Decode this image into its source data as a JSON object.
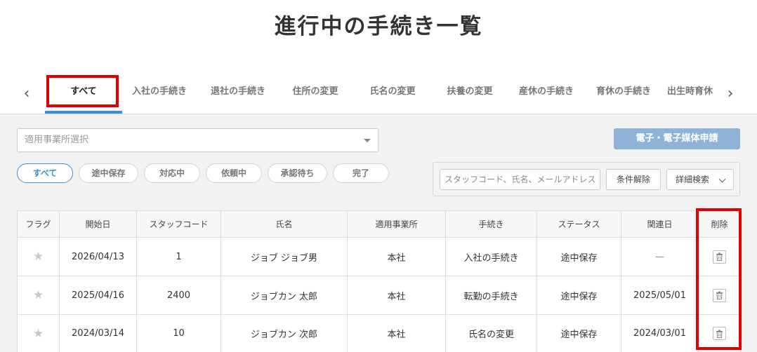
{
  "page": {
    "title": "進行中の手続き一覧"
  },
  "tabs": {
    "items": [
      {
        "label": "すべて"
      },
      {
        "label": "入社の手続き"
      },
      {
        "label": "退社の手続き"
      },
      {
        "label": "住所の変更"
      },
      {
        "label": "氏名の変更"
      },
      {
        "label": "扶養の変更"
      },
      {
        "label": "産休の手続き"
      },
      {
        "label": "育休の手続き"
      },
      {
        "label": "出生時育休"
      }
    ]
  },
  "office_select": {
    "placeholder": "適用事業所選択"
  },
  "apply_button": {
    "label": "電子・電子媒体申請"
  },
  "status_filters": [
    {
      "label": "すべて"
    },
    {
      "label": "途中保存"
    },
    {
      "label": "対応中"
    },
    {
      "label": "依頼中"
    },
    {
      "label": "承認待ち"
    },
    {
      "label": "完了"
    }
  ],
  "search": {
    "placeholder": "スタッフコード、氏名、メールアドレス",
    "clear_label": "条件解除",
    "advanced_label": "詳細検索"
  },
  "table": {
    "headers": [
      "フラグ",
      "開始日",
      "スタッフコード",
      "氏名",
      "適用事業所",
      "手続き",
      "ステータス",
      "関連日",
      "削除"
    ],
    "rows": [
      {
        "start": "2026/04/13",
        "code": "1",
        "name": "ジョブ ジョブ男",
        "office": "本社",
        "procedure": "入社の手続き",
        "status": "途中保存",
        "related": "—"
      },
      {
        "start": "2025/04/16",
        "code": "2400",
        "name": "ジョブカン 太郎",
        "office": "本社",
        "procedure": "転勤の手続き",
        "status": "途中保存",
        "related": "2025/05/01"
      },
      {
        "start": "2024/03/14",
        "code": "10",
        "name": "ジョブカン 次郎",
        "office": "本社",
        "procedure": "氏名の変更",
        "status": "途中保存",
        "related": "2024/03/01"
      }
    ]
  },
  "colors": {
    "accent": "#3d8fd6",
    "highlight": "#e00000",
    "apply_button": "#8fb3d6"
  }
}
